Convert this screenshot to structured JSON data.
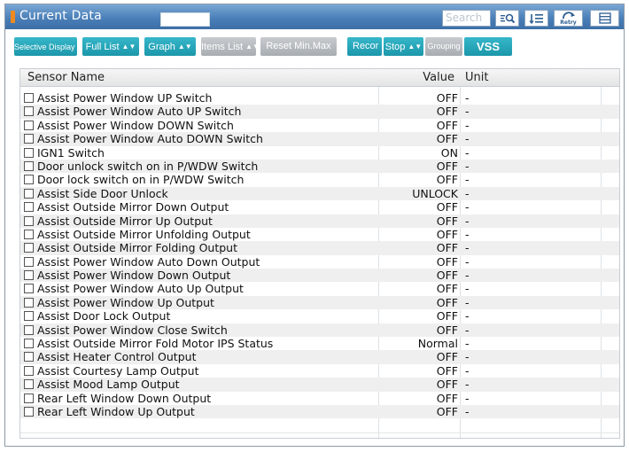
{
  "window": {
    "title": "Current Data",
    "search_placeholder": "Search",
    "retry_label": "Retry"
  },
  "toolbar": {
    "selective_display": "Selective Display",
    "full_list": "Full List",
    "graph": "Graph",
    "items_list": "Items List",
    "reset_min_max": "Reset Min.Max",
    "record": "Recor",
    "stop": "Stop",
    "grouping": "Grouping",
    "vss": "VSS"
  },
  "table": {
    "headers": {
      "name": "Sensor Name",
      "value": "Value",
      "unit": "Unit"
    },
    "rows": [
      {
        "name": "Assist Power Window UP Switch",
        "value": "OFF",
        "unit": "-"
      },
      {
        "name": "Assist Power Window Auto UP Switch",
        "value": "OFF",
        "unit": "-"
      },
      {
        "name": "Assist Power Window DOWN Switch",
        "value": "OFF",
        "unit": "-"
      },
      {
        "name": "Assist Power Window Auto DOWN Switch",
        "value": "OFF",
        "unit": "-"
      },
      {
        "name": "IGN1 Switch",
        "value": "ON",
        "unit": "-"
      },
      {
        "name": "Door unlock switch on in P/WDW Switch",
        "value": "OFF",
        "unit": "-"
      },
      {
        "name": "Door lock switch on in P/WDW Switch",
        "value": "OFF",
        "unit": "-"
      },
      {
        "name": "Assist Side Door Unlock",
        "value": "UNLOCK",
        "unit": "-"
      },
      {
        "name": "Assist Outside Mirror Down Output",
        "value": "OFF",
        "unit": "-"
      },
      {
        "name": "Assist Outside Mirror Up Output",
        "value": "OFF",
        "unit": "-"
      },
      {
        "name": "Assist Outside Mirror Unfolding Output",
        "value": "OFF",
        "unit": "-"
      },
      {
        "name": "Assist Outside Mirror Folding Output",
        "value": "OFF",
        "unit": "-"
      },
      {
        "name": "Assist Power Window Auto Down Output",
        "value": "OFF",
        "unit": "-"
      },
      {
        "name": "Assist Power Window Down Output",
        "value": "OFF",
        "unit": "-"
      },
      {
        "name": "Assist Power Window Auto Up Output",
        "value": "OFF",
        "unit": "-"
      },
      {
        "name": "Assist Power Window Up Output",
        "value": "OFF",
        "unit": "-"
      },
      {
        "name": "Assist Door Lock Output",
        "value": "OFF",
        "unit": "-"
      },
      {
        "name": "Assist Power Window Close Switch",
        "value": "OFF",
        "unit": "-"
      },
      {
        "name": "Assist Outside Mirror Fold Motor IPS Status",
        "value": "Normal",
        "unit": "-"
      },
      {
        "name": "Assist Heater Control Output",
        "value": "OFF",
        "unit": "-"
      },
      {
        "name": "Assist Courtesy Lamp Output",
        "value": "OFF",
        "unit": "-"
      },
      {
        "name": "Assist Mood Lamp Output",
        "value": "OFF",
        "unit": "-"
      },
      {
        "name": "Rear Left Window Down Output",
        "value": "OFF",
        "unit": "-"
      },
      {
        "name": "Rear Left Window Up Output",
        "value": "OFF",
        "unit": "-"
      }
    ]
  },
  "colors": {
    "titlebar": "#4a7fb8",
    "accent": "#f08a1e",
    "teal_button": "#1d97ab",
    "gray_button": "#a8adb2"
  }
}
